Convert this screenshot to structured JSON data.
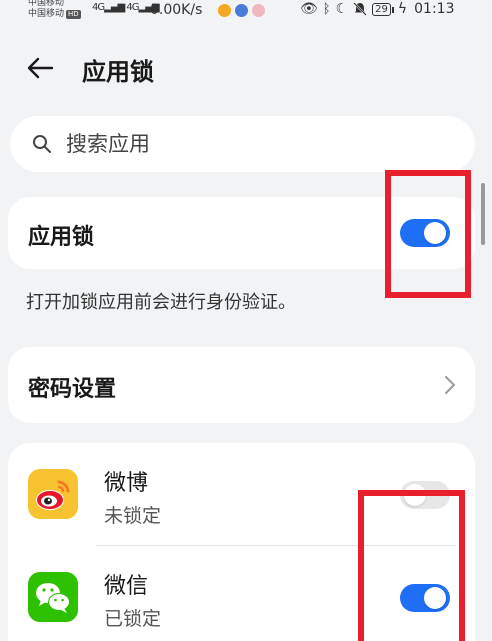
{
  "status_bar": {
    "carrier_1": "中国移动",
    "carrier_2": "中国移动",
    "hd_badge": "HD",
    "signal_1": "4G",
    "signal_2": "4G",
    "net_speed": "0.00K/s",
    "battery": "29",
    "time": "01:13",
    "icons": [
      "eye-icon",
      "bluetooth-icon",
      "moon-icon",
      "mute-bell-icon",
      "battery-icon",
      "charging-icon"
    ]
  },
  "header": {
    "title": "应用锁",
    "back_icon": "back-arrow-icon"
  },
  "search": {
    "placeholder": "搜索应用",
    "icon": "search-icon"
  },
  "app_lock": {
    "label": "应用锁",
    "enabled": true,
    "hint": "打开加锁应用前会进行身份验证。"
  },
  "password_settings": {
    "label": "密码设置",
    "icon": "chevron-right-icon"
  },
  "apps": [
    {
      "name": "微博",
      "status": "未锁定",
      "locked": false,
      "icon": "weibo-icon"
    },
    {
      "name": "微信",
      "status": "已锁定",
      "locked": true,
      "icon": "wechat-icon"
    }
  ],
  "colors": {
    "background": "#f1f3f5",
    "card": "#ffffff",
    "accent": "#1e6ff5",
    "highlight": "#e8202e",
    "toggle_off": "#e7e7e7"
  }
}
